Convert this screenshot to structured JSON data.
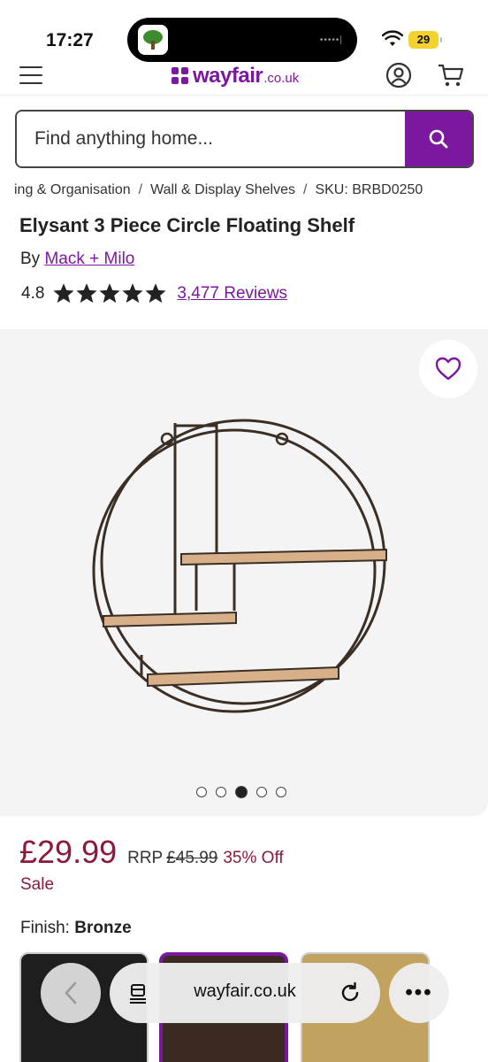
{
  "status_bar": {
    "time": "17:27",
    "battery": "29"
  },
  "header": {
    "logo_word": "wayfair",
    "logo_tld": ".co.uk"
  },
  "search": {
    "placeholder": "Find anything home..."
  },
  "breadcrumb": {
    "items": [
      "ing & Organisation",
      "Wall & Display Shelves",
      "SKU: BRBD0250"
    ]
  },
  "product": {
    "title": "Elysant 3 Piece Circle Floating Shelf",
    "brand_prefix": "By",
    "brand": "Mack + Milo",
    "rating": "4.8",
    "stars_filled": 5,
    "reviews": "3,477 Reviews"
  },
  "gallery": {
    "image_count": 5,
    "active_index": 2
  },
  "pricing": {
    "price": "£29.99",
    "rrp_label": "RRP",
    "was_price": "£45.99",
    "discount": "35% Off",
    "sale_label": "Sale"
  },
  "finish": {
    "label": "Finish:",
    "value": "Bronze"
  },
  "browser": {
    "url": "wayfair.co.uk",
    "more": "•••"
  },
  "colors": {
    "brand": "#7b189f",
    "price": "#8b1a3a"
  }
}
